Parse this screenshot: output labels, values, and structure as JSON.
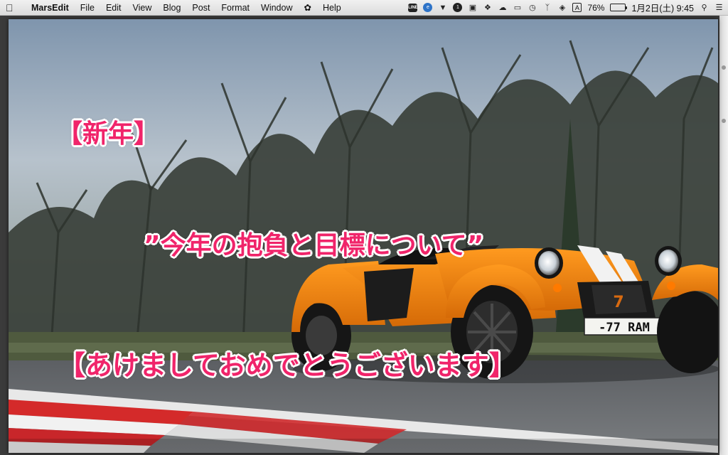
{
  "menubar": {
    "apple_icon": "apple-logo-icon",
    "app_name": "MarsEdit",
    "menus": [
      "File",
      "Edit",
      "View",
      "Blog",
      "Post",
      "Format",
      "Window",
      "Help"
    ],
    "tray": {
      "line_label": "LINE",
      "battery_percent": "76%",
      "battery_level": 0.76,
      "clock": "1月2日(土)  9:45"
    }
  },
  "captions": {
    "new_year": "【新年】",
    "resolution": "”今年の抱負と目標について”",
    "greeting": "【あけましておめでとうございます】"
  },
  "photo": {
    "license_plate": "-77 RAM",
    "badge_number": "7"
  }
}
